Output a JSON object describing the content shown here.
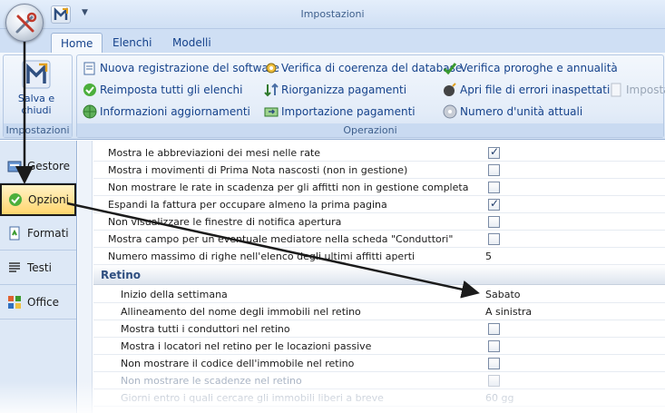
{
  "window": {
    "title": "Impostazioni"
  },
  "tabs": [
    "Home",
    "Elenchi",
    "Modelli"
  ],
  "ribbon": {
    "save_button": {
      "line1": "Salva e",
      "line2": "chiudi"
    },
    "group_impostazioni": "Impostazioni",
    "group_operazioni": "Operazioni",
    "commands": {
      "nuova_registrazione": "Nuova registrazione del software",
      "reimposta_elenchi": "Reimposta tutti gli elenchi",
      "informazioni_aggiornamenti": "Informazioni aggiornamenti",
      "verifica_coerenza": "Verifica di coerenza del database",
      "riorganizza_pagamenti": "Riorganizza pagamenti",
      "importazione_pagamenti": "Importazione pagamenti",
      "verifica_proroghe": "Verifica proroghe e annualità",
      "apri_file_errori": "Apri file di errori inaspettati",
      "numero_unita": "Numero d'unità attuali",
      "imposta_cut": "Imposta"
    }
  },
  "sidebar": [
    {
      "label": "Gestore"
    },
    {
      "label": "Opzioni"
    },
    {
      "label": "Formati"
    },
    {
      "label": "Testi"
    },
    {
      "label": "Office"
    }
  ],
  "options": [
    {
      "label": "Mostra le abbreviazioni dei mesi nelle rate",
      "checked": true
    },
    {
      "label": "Mostra i movimenti di Prima Nota nascosti (non in gestione)",
      "checked": false
    },
    {
      "label": "Non mostrare le rate in scadenza per gli affitti non in gestione completa",
      "checked": false
    },
    {
      "label": "Espandi la fattura per occupare almeno la prima pagina",
      "checked": true
    },
    {
      "label": "Non visualizzare le finestre di notifica apertura",
      "checked": false
    },
    {
      "label": "Mostra campo per un eventuale mediatore nella scheda \"Conduttori\"",
      "checked": false
    },
    {
      "label": "Numero massimo di righe nell'elenco degli ultimi affitti aperti",
      "value": "5"
    }
  ],
  "retino": {
    "section_title": "Retino",
    "rows": [
      {
        "label": "Inizio della settimana",
        "value": "Sabato"
      },
      {
        "label": "Allineamento del nome degli immobili nel retino",
        "value": "A sinistra"
      },
      {
        "label": "Mostra tutti i conduttori nel retino",
        "checked": false
      },
      {
        "label": "Mostra i locatori nel retino per le locazioni passive",
        "checked": false
      },
      {
        "label": "Non mostrare il codice dell'immobile nel retino",
        "checked": false
      },
      {
        "label": "Non mostrare le scadenze nel retino",
        "checked": false
      },
      {
        "label": "Giorni entro i quali cercare gli immobili liberi a breve",
        "value": "60 gg"
      }
    ]
  }
}
